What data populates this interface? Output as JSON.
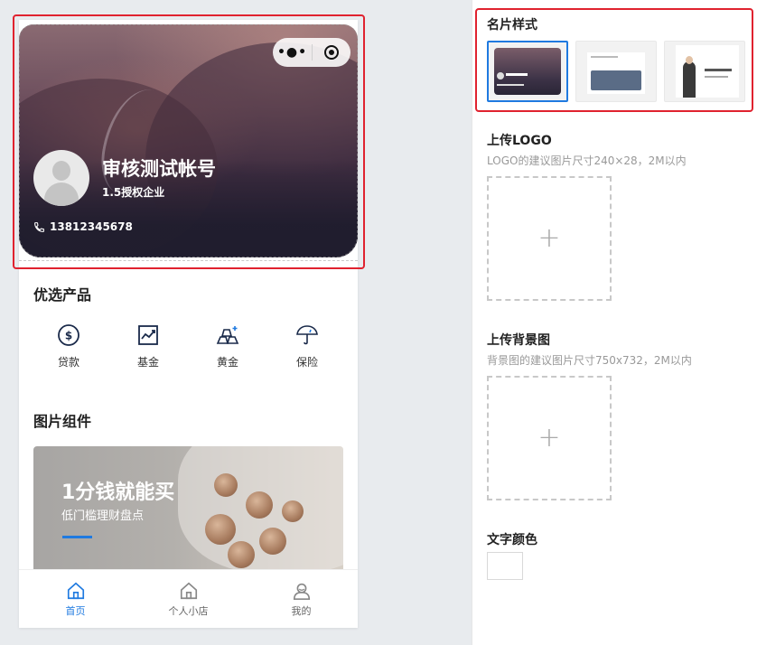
{
  "card": {
    "name": "审核测试帐号",
    "company": "1.5授权企业",
    "phone": "13812345678",
    "menu_dots": "•●•"
  },
  "products": {
    "title": "优选产品",
    "items": [
      {
        "label": "贷款",
        "icon": "dollar-circle-icon"
      },
      {
        "label": "基金",
        "icon": "trend-chart-icon"
      },
      {
        "label": "黄金",
        "icon": "gold-bars-icon"
      },
      {
        "label": "保险",
        "icon": "umbrella-icon"
      }
    ]
  },
  "picture": {
    "title": "图片组件",
    "banner_title": "1分钱就能买",
    "banner_subtitle": "低门槛理财盘点"
  },
  "tabbar": {
    "items": [
      {
        "label": "首页",
        "active": true
      },
      {
        "label": "个人小店",
        "active": false
      },
      {
        "label": "我的",
        "active": false
      }
    ]
  },
  "panel": {
    "style_title": "名片样式",
    "logo_title": "上传LOGO",
    "logo_hint": "LOGO的建议图片尺寸240×28，2M以内",
    "bg_title": "上传背景图",
    "bg_hint": "背景图的建议图片尺寸750x732，2M以内",
    "color_title": "文字颜色",
    "plus": "+"
  },
  "colors": {
    "accent": "#1f7ae0",
    "highlight": "#e0222f",
    "page_bg": "#e8ebee"
  }
}
